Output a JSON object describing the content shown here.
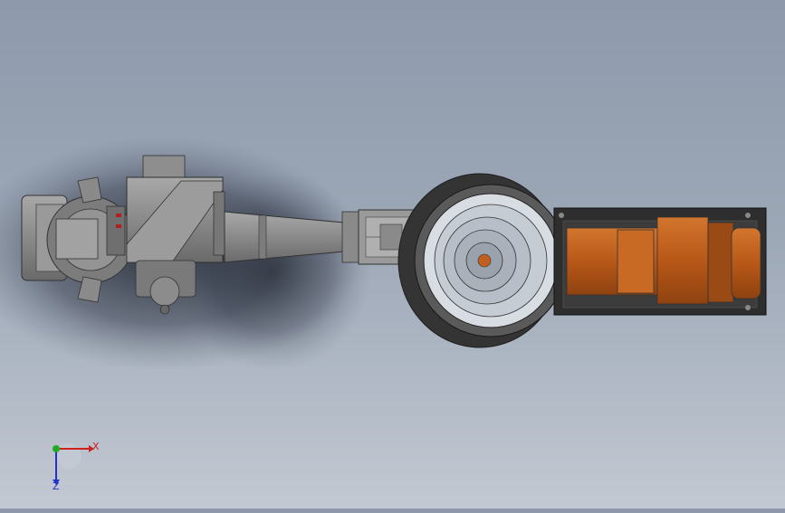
{
  "viewport": {
    "background_top": "#8e9aac",
    "background_bottom": "#c3c9d2",
    "model_colors": {
      "arm_gray": "#8c8c8c",
      "arm_dark": "#555555",
      "base_orange": "#c0601c",
      "base_plate": "#2e2e2e",
      "turntable": "#3a3a3a"
    }
  },
  "triad": {
    "x_label": "X",
    "z_label": "Z",
    "x_color": "#cc2222",
    "y_color": "#22aa22",
    "z_color": "#2233cc"
  }
}
